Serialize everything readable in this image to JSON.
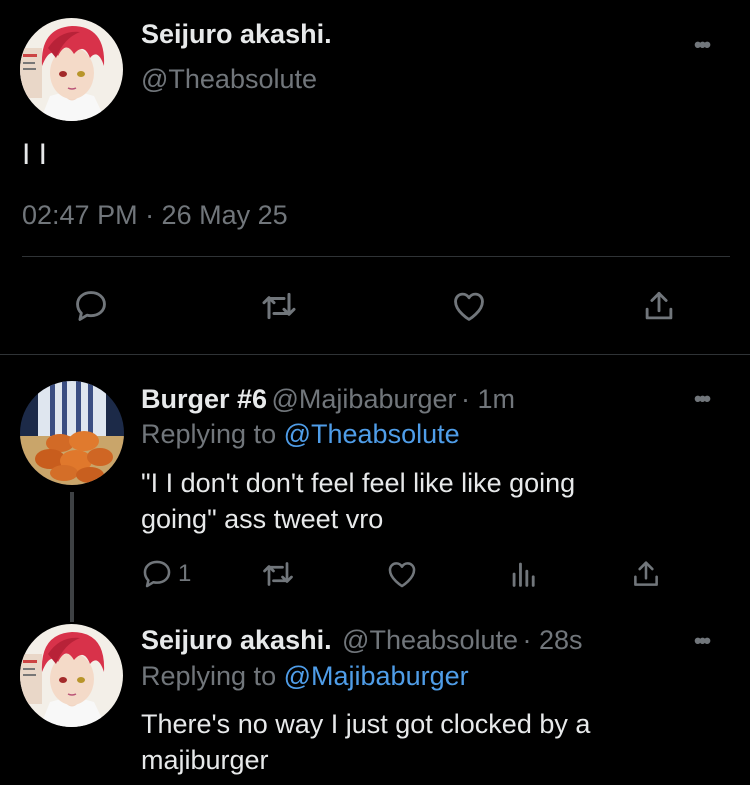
{
  "main_tweet": {
    "display_name": "Seijuro akashi.",
    "handle": "@Theabsolute",
    "text": "I I",
    "timestamp": "02:47 PM · 26 May 25",
    "actions": [
      "reply-icon",
      "retweet-icon",
      "like-icon",
      "share-icon"
    ]
  },
  "reply_1": {
    "display_name": "Burger #6",
    "handle": "@Majibaburger",
    "time": "· 1m",
    "replying_prefix": "Replying to",
    "replying_to": "@Theabsolute",
    "text_line1": "\"I I don't don't  feel feel like like going",
    "text_line2": "going\" ass tweet vro",
    "reply_count": "1",
    "actions": [
      "reply-icon",
      "retweet-icon",
      "like-icon",
      "analytics-icon",
      "share-icon"
    ]
  },
  "reply_2": {
    "display_name": "Seijuro akashi.",
    "handle": "@Theabsolute",
    "time": "· 28s",
    "replying_prefix": "Replying to",
    "replying_to": "@Majibaburger",
    "text_line1": "There's no way I just got clocked by a",
    "text_line2": "majiburger"
  },
  "more_label": "•••",
  "colors": {
    "background": "#000000",
    "text": "#e7e9ea",
    "muted": "#71767b",
    "link": "#4f9de8",
    "divider": "#2f3336"
  }
}
